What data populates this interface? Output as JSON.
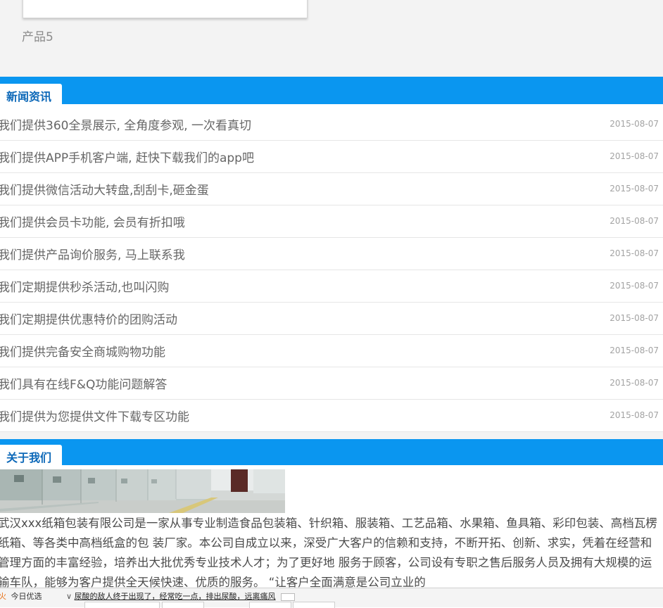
{
  "products": {
    "last_label": "产品5"
  },
  "news": {
    "title": "新闻资讯",
    "items": [
      {
        "title": "我们提供360全景展示, 全角度参观, 一次看真切",
        "date": "2015-08-07"
      },
      {
        "title": "我们提供APP手机客户端, 赶快下载我们的app吧",
        "date": "2015-08-07"
      },
      {
        "title": "我们提供微信活动大转盘,刮刮卡,砸金蛋",
        "date": "2015-08-07"
      },
      {
        "title": "我们提供会员卡功能, 会员有折扣哦",
        "date": "2015-08-07"
      },
      {
        "title": "我们提供产品询价服务, 马上联系我",
        "date": "2015-08-07"
      },
      {
        "title": "我们定期提供秒杀活动,也叫闪购",
        "date": "2015-08-07"
      },
      {
        "title": "我们定期提供优惠特价的团购活动",
        "date": "2015-08-07"
      },
      {
        "title": "我们提供完备安全商城购物功能",
        "date": "2015-08-07"
      },
      {
        "title": "我们具有在线F&Q功能问题解答",
        "date": "2015-08-07"
      },
      {
        "title": "我们提供为您提供文件下载专区功能",
        "date": "2015-08-07"
      }
    ]
  },
  "about": {
    "title": "关于我们",
    "text": "武汉xxx纸箱包装有限公司是一家从事专业制造食品包装箱、针织箱、服装箱、工艺品箱、水果箱、鱼具箱、彩印包装、高档瓦楞纸箱、等各类中高档纸盒的包 装厂家。本公司自成立以来，深受广大客户的信赖和支持，不断开拓、创新、求实，凭着在经营和管理方面的丰富经验，培养出大批优秀专业技术人才；为了更好地 服务于顾客，公司设有专职之售后服务人员及拥有大规模的运输车队，能够为客户提供全天候快速、优质的服务。 “让客户全面满意是公司立业的"
  },
  "statusbar": {
    "left_label": "今日优选",
    "right_text": "尿酸的敌人终于出现了，经常吃一点，排出尿酸，远离痛风"
  },
  "colors": {
    "accent": "#0a96f0",
    "section_title": "#0c68b8"
  }
}
